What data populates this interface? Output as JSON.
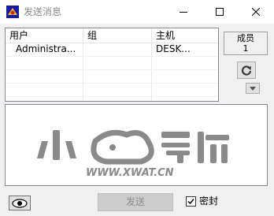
{
  "window": {
    "title": "发送消息",
    "minimize_icon": "minimize-icon",
    "maximize_icon": "maximize-icon",
    "close_icon": "close-icon"
  },
  "user_list": {
    "columns": [
      "用户",
      "组",
      "主机"
    ],
    "rows": [
      {
        "user": "Administra...",
        "group": "",
        "host": "DESK..."
      }
    ]
  },
  "members": {
    "label": "成员",
    "count": "1"
  },
  "buttons": {
    "refresh_icon": "refresh-icon",
    "dropdown_icon": "dropdown-arrow-icon",
    "eye_icon": "eye-icon",
    "send_label": "发送"
  },
  "options": {
    "secret_label": "密封",
    "secret_checked": true
  },
  "watermark": {
    "text": "小导航",
    "url": "WWW.XWAT.CN"
  },
  "colors": {
    "title_text": "#8a8a8a",
    "disabled_button": "#cccccc",
    "watermark": "#8a8a8a"
  }
}
